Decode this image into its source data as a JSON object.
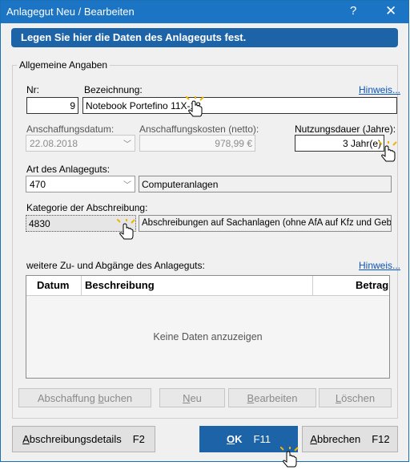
{
  "window": {
    "title": "Anlagegut Neu / Bearbeiten",
    "help": "?",
    "close": "✕"
  },
  "banner": "Legen Sie hier die Daten des Anlageguts fest.",
  "group": {
    "title": "Allgemeine Angaben",
    "hinweis": "Hinweis...",
    "nr_label": "Nr:",
    "nr_value": "9",
    "bezeichnung_label": "Bezeichnung:",
    "bezeichnung_value": "Notebook Portefino 11X-13",
    "anschaffungsdatum_label": "Anschaffungsdatum:",
    "anschaffungsdatum_value": "22.08.2018",
    "anschaffungskosten_label": "Anschaffungskosten (netto):",
    "anschaffungskosten_value": "978,99 €",
    "nutzungsdauer_label": "Nutzungsdauer (Jahre):",
    "nutzungsdauer_value": "3 Jahr(e)",
    "art_label": "Art des Anlageguts:",
    "art_code": "470",
    "art_text": "Computeranlagen",
    "kategorie_label": "Kategorie der Abschreibung:",
    "kategorie_code": "4830",
    "kategorie_text": "Abschreibungen auf Sachanlagen (ohne AfA auf Kfz und Gebäude)",
    "zugaenge_label": "weitere Zu- und Abgänge des Anlageguts:",
    "zugaenge_hinweis": "Hinweis...",
    "table": {
      "headers": [
        "Datum",
        "Beschreibung",
        "Betrag"
      ],
      "empty": "Keine Daten anzuzeigen"
    },
    "buttons": {
      "abschaffung_a": "Abschaffung ",
      "abschaffung_u": "b",
      "abschaffung_b": "uchen",
      "neu_u": "N",
      "neu_b": "eu",
      "bearbeiten_u": "B",
      "bearbeiten_b": "earbeiten",
      "loeschen_u": "L",
      "loeschen_b": "öschen"
    }
  },
  "footer": {
    "details_u": "A",
    "details_b": "bschreibungsdetails",
    "details_key": "F2",
    "ok_u": "O",
    "ok_b": "K",
    "ok_key": "F11",
    "cancel_u": "A",
    "cancel_b": "bbrechen",
    "cancel_key": "F12"
  },
  "colors": {
    "accent": "#1c63a8",
    "titlebar": "#1c74c4",
    "link": "#0b53b6"
  }
}
